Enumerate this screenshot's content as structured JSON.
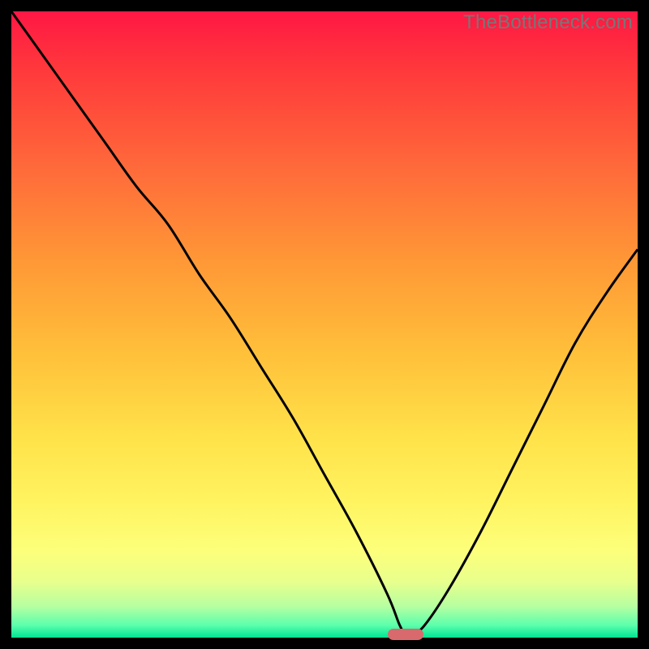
{
  "watermark": "TheBottleneck.com",
  "colors": {
    "background": "#000000",
    "curve": "#000000",
    "marker": "#d86a6d",
    "gradient_top": "#ff1744",
    "gradient_bottom": "#00e593"
  },
  "chart_data": {
    "type": "line",
    "title": "",
    "xlabel": "",
    "ylabel": "",
    "xlim": [
      0,
      100
    ],
    "ylim": [
      0,
      100
    ],
    "x": [
      0,
      5,
      10,
      15,
      20,
      25,
      30,
      35,
      40,
      45,
      50,
      55,
      60,
      62,
      63,
      64,
      66,
      70,
      75,
      80,
      85,
      90,
      95,
      100
    ],
    "series": [
      {
        "name": "bottleneck-curve",
        "values": [
          100,
          93,
          86,
          79,
          72,
          66,
          58,
          51,
          43,
          35,
          26,
          17,
          7,
          2,
          0.5,
          0.5,
          2,
          8,
          17,
          27,
          37,
          47,
          55,
          62
        ]
      }
    ],
    "marker": {
      "x": 63,
      "y": 0.5
    },
    "annotations": []
  }
}
